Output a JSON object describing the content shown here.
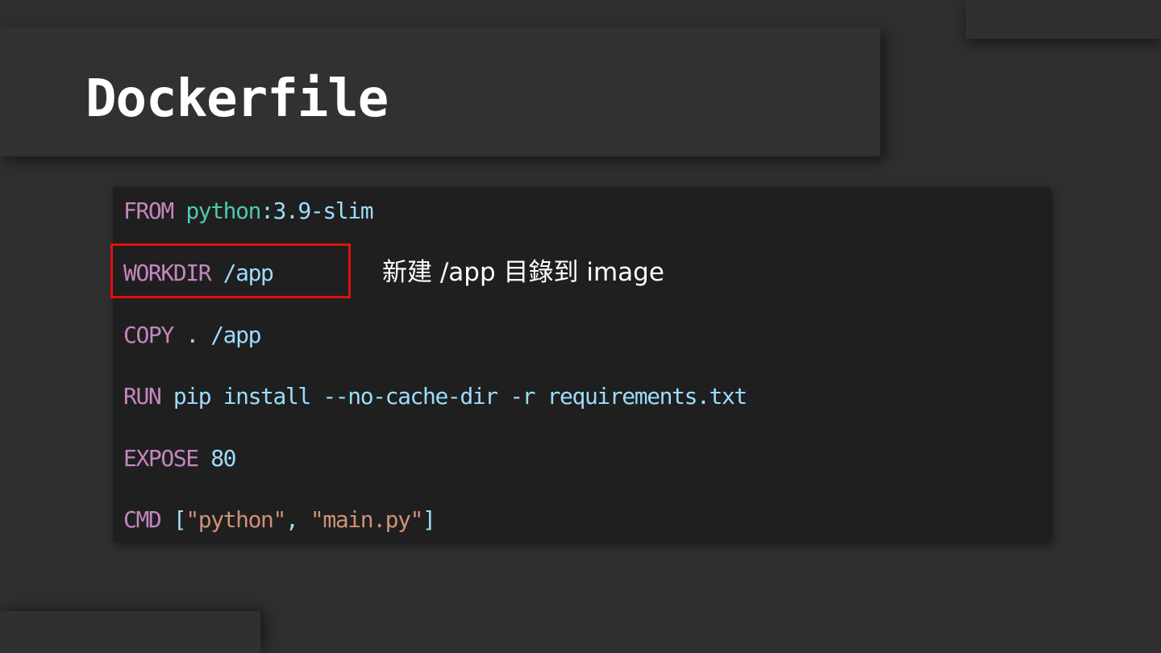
{
  "slide": {
    "title": "Dockerfile"
  },
  "code": {
    "lines": [
      {
        "keyword": "FROM",
        "image": "python",
        "tag": ":3.9-slim"
      },
      {
        "keyword": "WORKDIR",
        "arg": "/app"
      },
      {
        "keyword": "COPY",
        "arg": ". /app"
      },
      {
        "keyword": "RUN",
        "arg": "pip install --no-cache-dir -r requirements.txt"
      },
      {
        "keyword": "EXPOSE",
        "arg": "80"
      },
      {
        "keyword": "CMD",
        "open": "[",
        "s1": "\"python\"",
        "sep": ", ",
        "s2": "\"main.py\"",
        "close": "]"
      }
    ]
  },
  "annotation": {
    "text": "新建 /app 目錄到 image"
  },
  "colors": {
    "background": "#2f2f2f",
    "code_background": "#1f1f1f",
    "keyword": "#c586c0",
    "image_name": "#4ec9b0",
    "argument": "#9cdcfe",
    "string": "#ce9178",
    "highlight_border": "#e01010"
  }
}
